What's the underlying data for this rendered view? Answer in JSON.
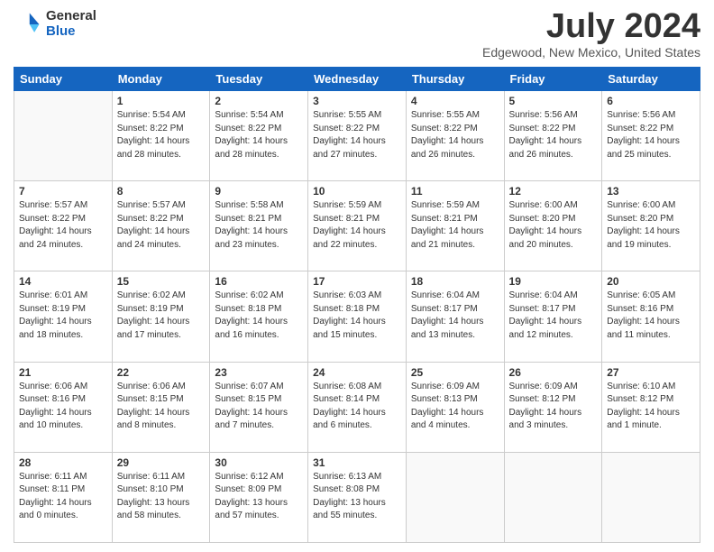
{
  "logo": {
    "general": "General",
    "blue": "Blue"
  },
  "title": {
    "month": "July 2024",
    "location": "Edgewood, New Mexico, United States"
  },
  "weekdays": [
    "Sunday",
    "Monday",
    "Tuesday",
    "Wednesday",
    "Thursday",
    "Friday",
    "Saturday"
  ],
  "weeks": [
    [
      {
        "day": "",
        "info": ""
      },
      {
        "day": "1",
        "info": "Sunrise: 5:54 AM\nSunset: 8:22 PM\nDaylight: 14 hours\nand 28 minutes."
      },
      {
        "day": "2",
        "info": "Sunrise: 5:54 AM\nSunset: 8:22 PM\nDaylight: 14 hours\nand 28 minutes."
      },
      {
        "day": "3",
        "info": "Sunrise: 5:55 AM\nSunset: 8:22 PM\nDaylight: 14 hours\nand 27 minutes."
      },
      {
        "day": "4",
        "info": "Sunrise: 5:55 AM\nSunset: 8:22 PM\nDaylight: 14 hours\nand 26 minutes."
      },
      {
        "day": "5",
        "info": "Sunrise: 5:56 AM\nSunset: 8:22 PM\nDaylight: 14 hours\nand 26 minutes."
      },
      {
        "day": "6",
        "info": "Sunrise: 5:56 AM\nSunset: 8:22 PM\nDaylight: 14 hours\nand 25 minutes."
      }
    ],
    [
      {
        "day": "7",
        "info": "Sunrise: 5:57 AM\nSunset: 8:22 PM\nDaylight: 14 hours\nand 24 minutes."
      },
      {
        "day": "8",
        "info": "Sunrise: 5:57 AM\nSunset: 8:22 PM\nDaylight: 14 hours\nand 24 minutes."
      },
      {
        "day": "9",
        "info": "Sunrise: 5:58 AM\nSunset: 8:21 PM\nDaylight: 14 hours\nand 23 minutes."
      },
      {
        "day": "10",
        "info": "Sunrise: 5:59 AM\nSunset: 8:21 PM\nDaylight: 14 hours\nand 22 minutes."
      },
      {
        "day": "11",
        "info": "Sunrise: 5:59 AM\nSunset: 8:21 PM\nDaylight: 14 hours\nand 21 minutes."
      },
      {
        "day": "12",
        "info": "Sunrise: 6:00 AM\nSunset: 8:20 PM\nDaylight: 14 hours\nand 20 minutes."
      },
      {
        "day": "13",
        "info": "Sunrise: 6:00 AM\nSunset: 8:20 PM\nDaylight: 14 hours\nand 19 minutes."
      }
    ],
    [
      {
        "day": "14",
        "info": "Sunrise: 6:01 AM\nSunset: 8:19 PM\nDaylight: 14 hours\nand 18 minutes."
      },
      {
        "day": "15",
        "info": "Sunrise: 6:02 AM\nSunset: 8:19 PM\nDaylight: 14 hours\nand 17 minutes."
      },
      {
        "day": "16",
        "info": "Sunrise: 6:02 AM\nSunset: 8:18 PM\nDaylight: 14 hours\nand 16 minutes."
      },
      {
        "day": "17",
        "info": "Sunrise: 6:03 AM\nSunset: 8:18 PM\nDaylight: 14 hours\nand 15 minutes."
      },
      {
        "day": "18",
        "info": "Sunrise: 6:04 AM\nSunset: 8:17 PM\nDaylight: 14 hours\nand 13 minutes."
      },
      {
        "day": "19",
        "info": "Sunrise: 6:04 AM\nSunset: 8:17 PM\nDaylight: 14 hours\nand 12 minutes."
      },
      {
        "day": "20",
        "info": "Sunrise: 6:05 AM\nSunset: 8:16 PM\nDaylight: 14 hours\nand 11 minutes."
      }
    ],
    [
      {
        "day": "21",
        "info": "Sunrise: 6:06 AM\nSunset: 8:16 PM\nDaylight: 14 hours\nand 10 minutes."
      },
      {
        "day": "22",
        "info": "Sunrise: 6:06 AM\nSunset: 8:15 PM\nDaylight: 14 hours\nand 8 minutes."
      },
      {
        "day": "23",
        "info": "Sunrise: 6:07 AM\nSunset: 8:15 PM\nDaylight: 14 hours\nand 7 minutes."
      },
      {
        "day": "24",
        "info": "Sunrise: 6:08 AM\nSunset: 8:14 PM\nDaylight: 14 hours\nand 6 minutes."
      },
      {
        "day": "25",
        "info": "Sunrise: 6:09 AM\nSunset: 8:13 PM\nDaylight: 14 hours\nand 4 minutes."
      },
      {
        "day": "26",
        "info": "Sunrise: 6:09 AM\nSunset: 8:12 PM\nDaylight: 14 hours\nand 3 minutes."
      },
      {
        "day": "27",
        "info": "Sunrise: 6:10 AM\nSunset: 8:12 PM\nDaylight: 14 hours\nand 1 minute."
      }
    ],
    [
      {
        "day": "28",
        "info": "Sunrise: 6:11 AM\nSunset: 8:11 PM\nDaylight: 14 hours\nand 0 minutes."
      },
      {
        "day": "29",
        "info": "Sunrise: 6:11 AM\nSunset: 8:10 PM\nDaylight: 13 hours\nand 58 minutes."
      },
      {
        "day": "30",
        "info": "Sunrise: 6:12 AM\nSunset: 8:09 PM\nDaylight: 13 hours\nand 57 minutes."
      },
      {
        "day": "31",
        "info": "Sunrise: 6:13 AM\nSunset: 8:08 PM\nDaylight: 13 hours\nand 55 minutes."
      },
      {
        "day": "",
        "info": ""
      },
      {
        "day": "",
        "info": ""
      },
      {
        "day": "",
        "info": ""
      }
    ]
  ]
}
